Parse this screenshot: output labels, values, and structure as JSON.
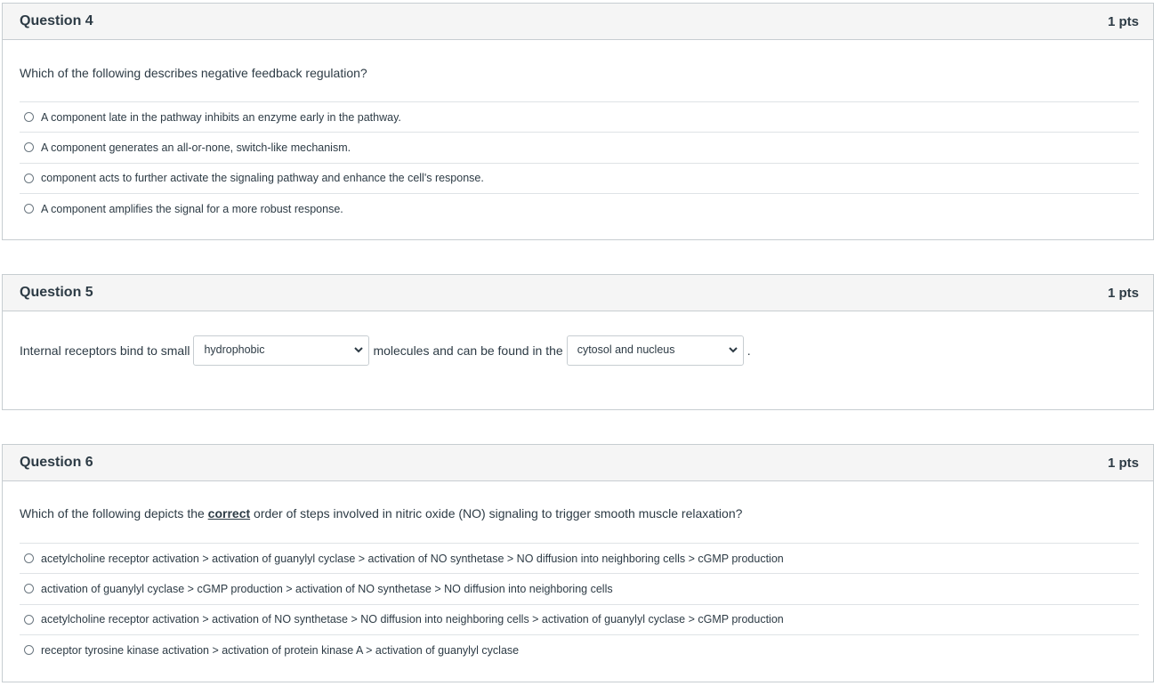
{
  "questions": {
    "q4": {
      "title": "Question 4",
      "points": "1 pts",
      "prompt": "Which of the following describes negative feedback regulation?",
      "answers": [
        "A component late in the pathway inhibits an enzyme early in the pathway.",
        "A component generates an all-or-none, switch-like mechanism.",
        "component acts to further activate the signaling pathway and enhance the cell's response.",
        "A component amplifies the signal for a more robust response."
      ]
    },
    "q5": {
      "title": "Question 5",
      "points": "1 pts",
      "text_before": "Internal receptors bind to small",
      "select1_value": "hydrophobic",
      "text_middle": "molecules and can be found in the",
      "select2_value": "cytosol and nucleus",
      "text_after": "."
    },
    "q6": {
      "title": "Question 6",
      "points": "1 pts",
      "prompt_before": "Which of the following depicts the",
      "prompt_emphasis": "correct",
      "prompt_after": "order of steps involved in nitric oxide (NO) signaling to trigger smooth muscle relaxation?",
      "answers": [
        "acetylcholine receptor activation > activation of guanylyl cyclase > activation of NO synthetase > NO diffusion into neighboring cells > cGMP production",
        "activation of guanylyl cyclase > cGMP production > activation of NO synthetase > NO diffusion into neighboring cells",
        "acetylcholine receptor activation > activation of NO synthetase > NO diffusion into neighboring cells > activation of guanylyl cyclase > cGMP production",
        "receptor tyrosine kinase activation > activation of protein kinase A > activation of guanylyl cyclase"
      ]
    }
  },
  "icons": {
    "radio": "radio-button-icon",
    "dropdown": "chevron-down-icon"
  }
}
